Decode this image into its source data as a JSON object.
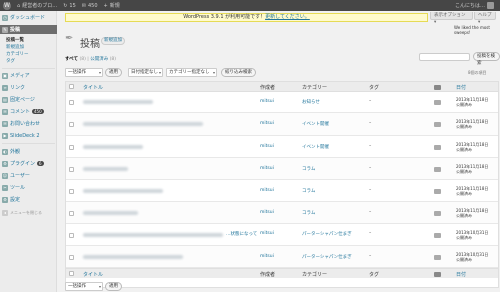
{
  "adminbar": {
    "site_name": "経営者のブロ…",
    "updates_count": "15",
    "comments_count": "450",
    "new_label": "新規",
    "howdy": "こんにちは…"
  },
  "sidebar": {
    "dashboard": "ダッシュボード",
    "posts": "投稿",
    "posts_sub": [
      "投稿一覧",
      "新規追加",
      "カテゴリー",
      "タグ"
    ],
    "media": "メディア",
    "links": "リンク",
    "pages": "固定ページ",
    "comments": "コメント",
    "comments_badge": "450",
    "contact": "お問い合わせ",
    "slidedeck": "SlideDeck 2",
    "appearance": "外観",
    "plugins": "プラグイン",
    "plugins_badge": "6",
    "users": "ユーザー",
    "tools": "ツール",
    "settings": "設定",
    "collapse": "メニューを閉じる"
  },
  "header": {
    "notice_text": "WordPress 3.9.1 が利用可能です！",
    "notice_link": "更新してください。",
    "screen_options": "表示オプション ▾",
    "help": "ヘルプ ▾",
    "update_link": "We liked the most sweeps!",
    "title": "投稿",
    "add_new": "新規追加"
  },
  "filters": {
    "all": "すべて",
    "all_count": "(8)",
    "published": "公開済み",
    "published_count": "(8)",
    "search_button": "投稿を検索",
    "bulk_action": "一括操作",
    "apply": "適用",
    "date_filter": "日付指定なし",
    "category_filter": "カテゴリー指定なし",
    "filter_button": "絞り込み検索",
    "item_count": "8個の項目"
  },
  "table": {
    "columns": {
      "title": "タイトル",
      "author": "作成者",
      "categories": "カテゴリー",
      "tags": "タグ",
      "date": "日付"
    },
    "rows": [
      {
        "title": "",
        "author": "mitsui",
        "category": "お知らせ",
        "tags": "–",
        "date": "2013年11月18日",
        "status": "公開済み"
      },
      {
        "title": "",
        "author": "mitsui",
        "category": "イベント開催",
        "tags": "–",
        "date": "2013年11月18日",
        "status": "公開済み"
      },
      {
        "title": "",
        "author": "mitsui",
        "category": "イベント開催",
        "tags": "–",
        "date": "2013年11月18日",
        "status": "公開済み"
      },
      {
        "title": "",
        "author": "mitsui",
        "category": "コラム",
        "tags": "–",
        "date": "2013年11月18日",
        "status": "公開済み"
      },
      {
        "title": "",
        "author": "mitsui",
        "category": "コラム",
        "tags": "–",
        "date": "2013年11月18日",
        "status": "公開済み"
      },
      {
        "title": "",
        "author": "mitsui",
        "category": "コラム",
        "tags": "–",
        "date": "2013年11月18日",
        "status": "公開済み"
      },
      {
        "title": "…状態になって",
        "author": "mitsui",
        "category": "パーターシャパン仕まぎ",
        "tags": "–",
        "date": "2013年10月31日",
        "status": "公開済み"
      },
      {
        "title": "",
        "author": "mitsui",
        "category": "パーターシャパン仕まぎ",
        "tags": "–",
        "date": "2013年10月31日",
        "status": "公開済み"
      }
    ]
  },
  "footer": {
    "bulk_action": "一括操作",
    "apply": "適用"
  }
}
